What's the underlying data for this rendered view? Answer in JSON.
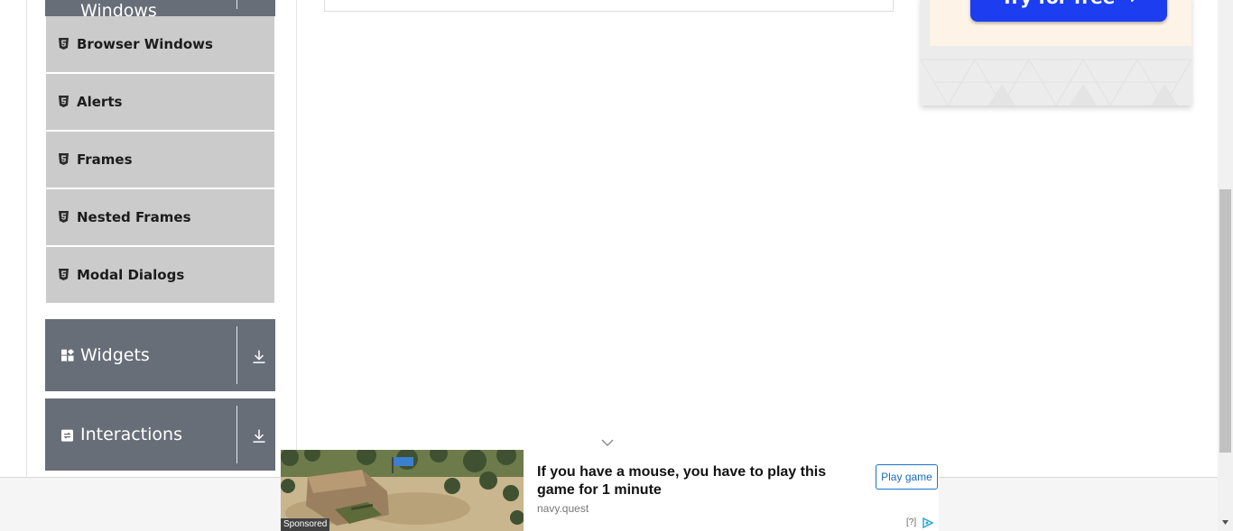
{
  "sidebar": {
    "top_group": {
      "title": "Windows"
    },
    "items": [
      {
        "label": "Browser Windows",
        "icon": "html5-icon"
      },
      {
        "label": "Alerts",
        "icon": "html5-icon"
      },
      {
        "label": "Frames",
        "icon": "html5-icon"
      },
      {
        "label": "Nested Frames",
        "icon": "html5-icon"
      },
      {
        "label": "Modal Dialogs",
        "icon": "html5-icon"
      }
    ],
    "groups": [
      {
        "title": "Widgets",
        "icon": "widgets-icon"
      },
      {
        "title": "Interactions",
        "icon": "interactions-icon"
      }
    ]
  },
  "right_ad": {
    "button_label": "Try for free →",
    "button_color": "#1c3ef0"
  },
  "bottom_ad": {
    "sponsored_label": "Sponsored",
    "headline": "If you have a mouse, you have to play this game for 1 minute",
    "domain": "navy.quest",
    "cta_label": "Play game",
    "help_label": "[?]"
  },
  "colors": {
    "group_header": "#686e78",
    "menu_item": "#cbcbcb",
    "cta_border": "#1a73c8"
  }
}
